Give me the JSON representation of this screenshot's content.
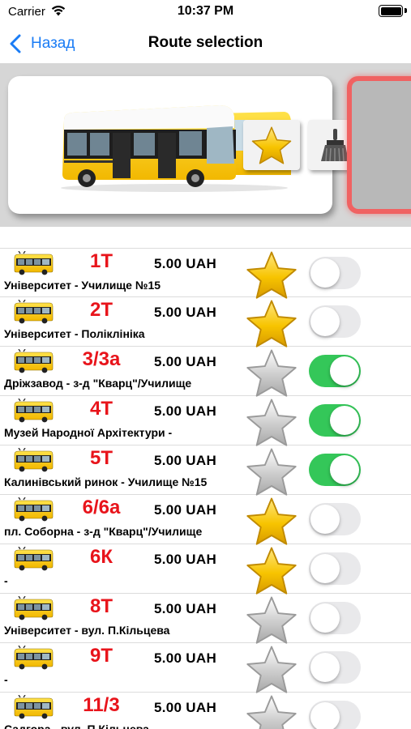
{
  "status_bar": {
    "carrier": "Carrier",
    "time": "10:37 PM"
  },
  "nav": {
    "back_label": "Назад",
    "title": "Route selection"
  },
  "icons": {
    "wifi": "wifi-icon",
    "battery": "battery-icon",
    "back": "chevron-left-icon",
    "bus": "bus-icon",
    "star": "star-icon",
    "brush": "brush-icon"
  },
  "colors": {
    "accent": "#1a7cf5",
    "route_number": "#e8141b",
    "toggle_on": "#34c759",
    "star_gold": "#f7c400",
    "star_gray": "#c8c8c8"
  },
  "routes": [
    {
      "number": "1Т",
      "price": "5.00  UAH",
      "name": "Університет - Училище №15",
      "favorite": true,
      "enabled": false
    },
    {
      "number": "2Т",
      "price": "5.00  UAH",
      "name": "Університет - Поліклініка",
      "favorite": true,
      "enabled": false
    },
    {
      "number": "3/3а",
      "price": "5.00  UAH",
      "name": "Дріжзавод - з-д \"Кварц\"/Училище",
      "favorite": false,
      "enabled": true
    },
    {
      "number": "4Т",
      "price": "5.00  UAH",
      "name": "Музей Народної Архітектури -",
      "favorite": false,
      "enabled": true
    },
    {
      "number": "5Т",
      "price": "5.00  UAH",
      "name": "Калинівський ринок - Училище №15",
      "favorite": false,
      "enabled": true
    },
    {
      "number": "6/6а",
      "price": "5.00  UAH",
      "name": "пл. Соборна - з-д \"Кварц\"/Училище",
      "favorite": true,
      "enabled": false
    },
    {
      "number": "6К",
      "price": "5.00  UAH",
      "name": "-",
      "favorite": true,
      "enabled": false
    },
    {
      "number": "8Т",
      "price": "5.00  UAH",
      "name": "Університет - вул. П.Кільцева",
      "favorite": false,
      "enabled": false
    },
    {
      "number": "9Т",
      "price": "5.00  UAH",
      "name": "-",
      "favorite": false,
      "enabled": false
    },
    {
      "number": "11/3",
      "price": "5.00  UAH",
      "name": "Садгора - вул. П.Кільцева",
      "favorite": false,
      "enabled": false
    }
  ]
}
